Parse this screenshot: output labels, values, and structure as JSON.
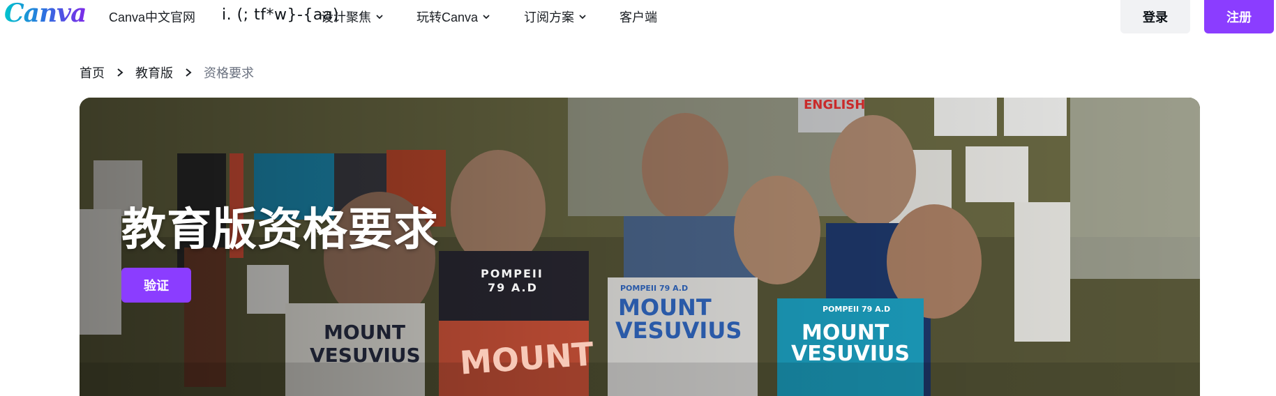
{
  "header": {
    "logo_text": "Canva",
    "nav": [
      {
        "label": "Canva中文官网"
      },
      {
        "label": "i. (; tf*w}-{aa)"
      },
      {
        "label": "设计聚焦"
      },
      {
        "label": "玩转Canva"
      },
      {
        "label": "订阅方案"
      },
      {
        "label": "客户端"
      }
    ],
    "login_label": "登录",
    "register_label": "注册",
    "colors": {
      "brand_purple": "#8b3dff",
      "login_bg": "#f1f2f4"
    }
  },
  "breadcrumb": {
    "items": [
      {
        "label": "首页"
      },
      {
        "label": "教育版"
      },
      {
        "label": "资格要求"
      }
    ]
  },
  "hero": {
    "title": "教育版资格要求",
    "button_label": "验证",
    "signs": {
      "english": "ENGLISH",
      "pompeii_small": "POMPEII 79 A.D",
      "mount_vesuvius_1": "MOUNT",
      "mount_vesuvius_2": "VESUVIUS",
      "pompeii_big_1": "POMPEII",
      "pompeii_big_2": "79 A.D",
      "mount_big": "MOUNT",
      "vesuvius_big": "VESUVIUS",
      "pompeii_teal": "POMPEII 79 A.D"
    }
  }
}
